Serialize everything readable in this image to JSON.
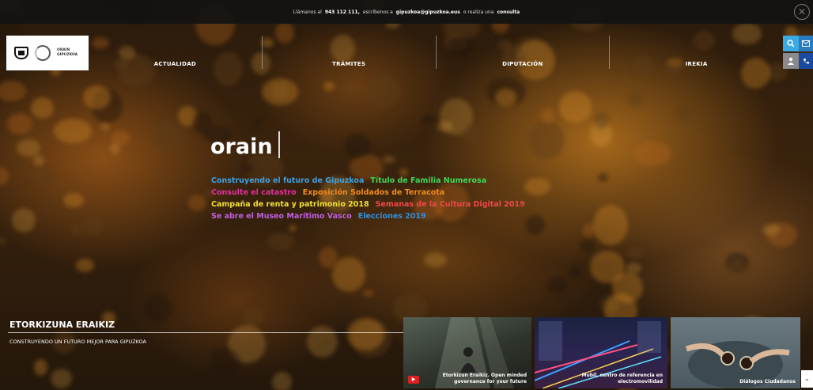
{
  "topbar": {
    "prefix": "Llámanos al",
    "phone": "943 112 111,",
    "middle": "escríbenos a",
    "email": "gipuzkoa@gipuzkoa.eus",
    "or": "o realiza una",
    "consulta": "consulta"
  },
  "logo": {
    "line1": "ORAIN",
    "line2": "GIPUZKOA"
  },
  "nav": [
    "ACTUALIDAD",
    "TRÁMITES",
    "DIPUTACIÓN",
    "IREKIA"
  ],
  "hero": {
    "brand": "orain"
  },
  "links": {
    "row1": [
      {
        "text": "Construyendo el futuro de Gipuzkoa",
        "color": "#3fa0e0"
      },
      {
        "text": "Título de Familia Numerosa",
        "color": "#3fd65a"
      }
    ],
    "row2": [
      {
        "text": "Consulte el catastro",
        "color": "#e0309a"
      },
      {
        "text": "Exposición Soldados de Terracota",
        "color": "#f08a20"
      }
    ],
    "row3": [
      {
        "text": "Campaña de renta y patrimonio 2018",
        "color": "#f0e030"
      },
      {
        "text": "Semanas de la Cultura Digital 2019",
        "color": "#f04848"
      }
    ],
    "row4": [
      {
        "text": "Se abre el Museo Marítimo Vasco",
        "color": "#c060e0"
      },
      {
        "text": "Elecciones 2019",
        "color": "#2f8fe0"
      }
    ]
  },
  "section": {
    "title": "ETORKIZUNA ERAIKIZ",
    "subtitle": "CONSTRUYENDO UN FUTURO MEJOR PARA GIPUZKOA"
  },
  "cards": [
    {
      "caption": "Etorkizun Eraikiz. Open minded governance for your future",
      "icon": "youtube-icon"
    },
    {
      "caption": "Mubil, centro de referencia en electromovilidad"
    },
    {
      "caption": "Diálogos Ciudadanos"
    }
  ],
  "icons": {
    "search": "search-icon",
    "mail": "mail-icon",
    "user": "user-icon",
    "phone": "phone-icon",
    "close": "close-icon",
    "chevron": "chevron-down-icon"
  }
}
